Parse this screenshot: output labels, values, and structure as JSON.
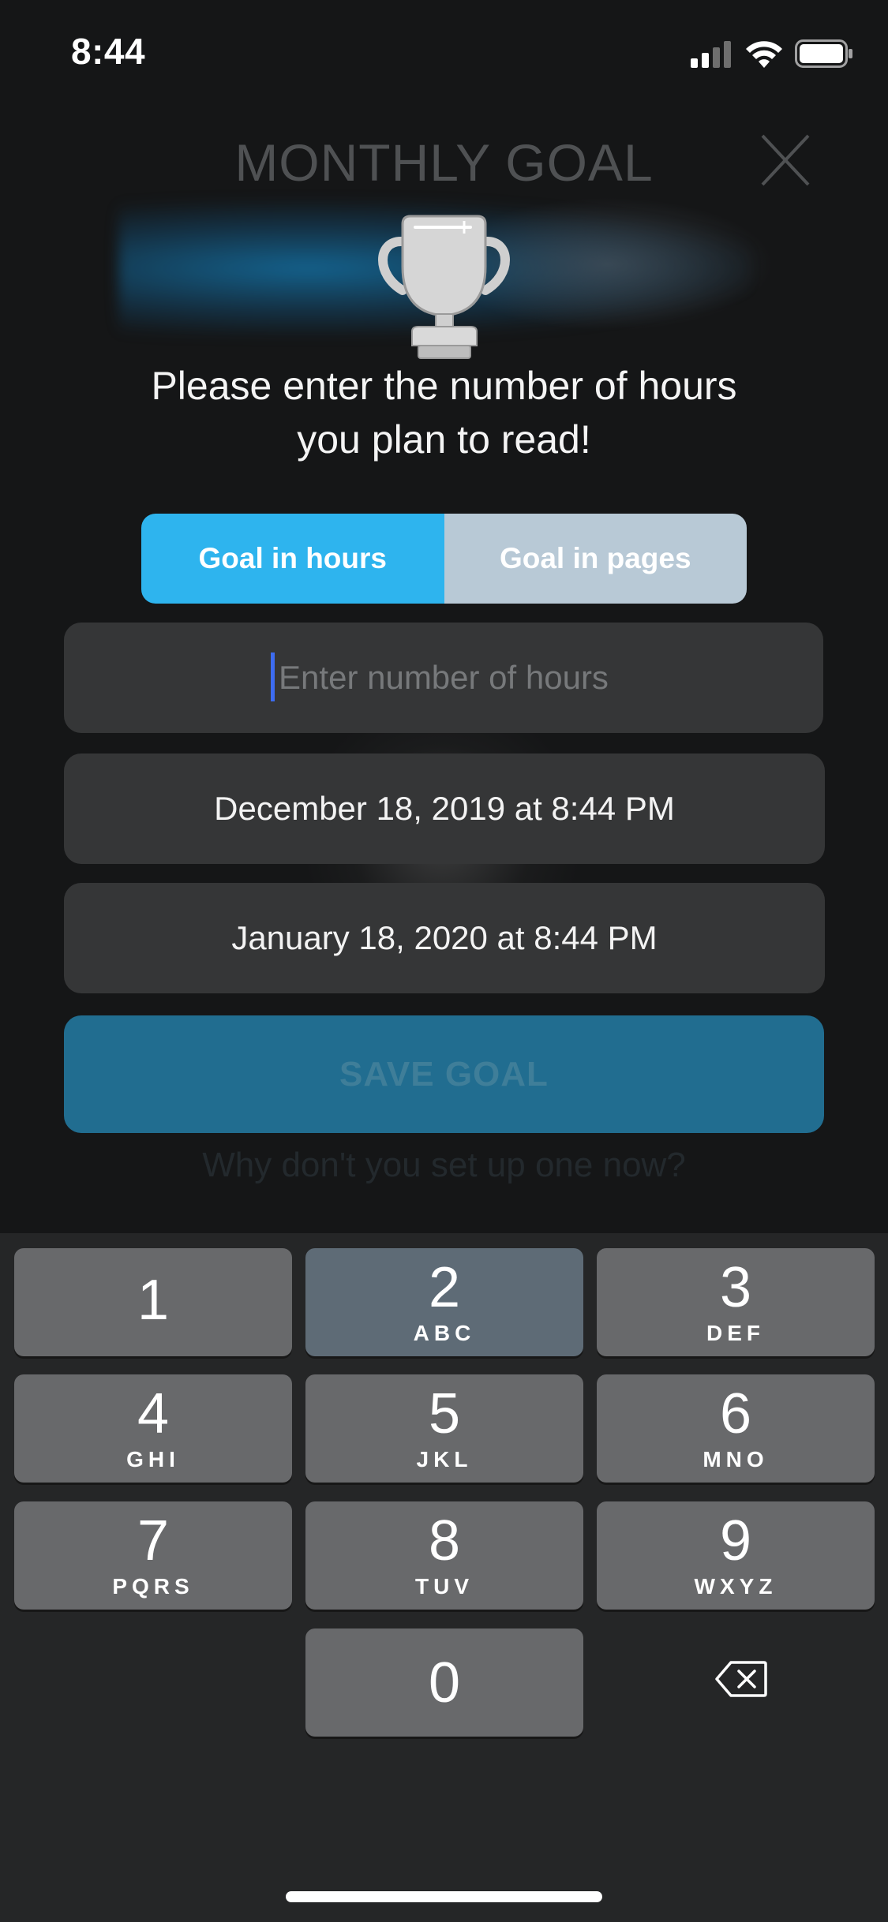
{
  "status_bar": {
    "time": "8:44"
  },
  "header": {
    "title": "MONTHLY GOAL",
    "close_label": "X"
  },
  "prompt": {
    "line1": "Please enter the number of hours",
    "line2": "you plan to read!"
  },
  "goal_type": {
    "options": [
      "Goal in hours",
      "Goal in pages"
    ],
    "selected": "Goal in hours"
  },
  "hours_input": {
    "value": "",
    "placeholder": "Enter number of hours"
  },
  "start_date": "December 18, 2019 at 8:44 PM",
  "end_date": "January 18, 2020 at 8:44 PM",
  "save_button": {
    "label": "SAVE GOAL"
  },
  "background_text": {
    "line2": "Why don't you set up one now?"
  },
  "keyboard": {
    "keys": [
      {
        "num": "1",
        "letters": ""
      },
      {
        "num": "2",
        "letters": "ABC"
      },
      {
        "num": "3",
        "letters": "DEF"
      },
      {
        "num": "4",
        "letters": "GHI"
      },
      {
        "num": "5",
        "letters": "JKL"
      },
      {
        "num": "6",
        "letters": "MNO"
      },
      {
        "num": "7",
        "letters": "PQRS"
      },
      {
        "num": "8",
        "letters": "TUV"
      },
      {
        "num": "9",
        "letters": "WXYZ"
      },
      {
        "num": "0",
        "letters": ""
      }
    ]
  },
  "colors": {
    "accent": "#2eb4ee",
    "segment_inactive": "#b8c9d6",
    "save_button": "#216d90",
    "caret": "#3d6cf1"
  }
}
